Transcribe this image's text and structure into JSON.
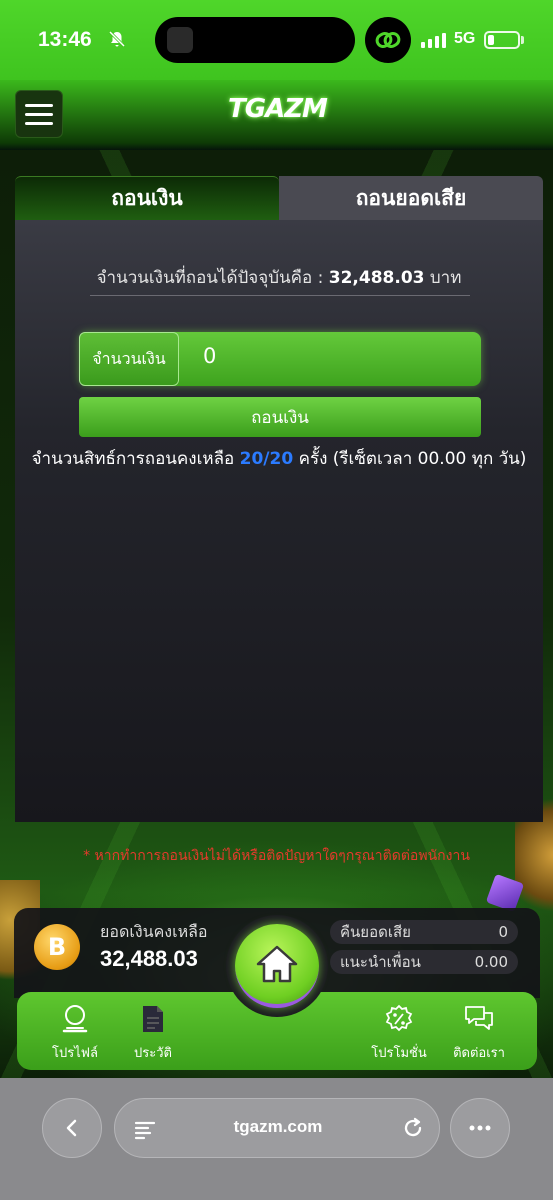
{
  "status_bar": {
    "time": "13:46",
    "network": "5G"
  },
  "header": {
    "logo_text": "TGAZM"
  },
  "tabs": [
    {
      "label": "ถอนเงิน",
      "active": true
    },
    {
      "label": "ถอนยอดเสีย",
      "active": false
    }
  ],
  "withdraw": {
    "available_prefix": "จำนวนเงินที่ถอนได้ปัจจุบันคือ :",
    "available_amount": "32,488.03",
    "available_unit": "บาท",
    "amount_label": "จำนวนเงิน",
    "amount_value": "0",
    "withdraw_button": "ถอนเงิน",
    "rights_prefix": "จำนวนสิทธ์การถอนคงเหลือ",
    "rights_count": "20/20",
    "rights_suffix": "ครั้ง (รีเซ็ตเวลา 00.00 ทุก วัน)"
  },
  "notice": "* หากทำการถอนเงินไม่ได้หรือติดปัญหาใดๆกรุณาติดต่อพนักงาน",
  "balance": {
    "label": "ยอดเงินคงเหลือ",
    "value": "32,488.03",
    "coin_symbol": "B",
    "cashback_label": "คืนยอดเสีย",
    "cashback_value": "0",
    "referral_label": "แนะนำเพื่อน",
    "referral_value": "0.00"
  },
  "bottom_nav": [
    {
      "label": "โปรไฟล์",
      "icon": "profile-icon"
    },
    {
      "label": "ประวัติ",
      "icon": "history-icon"
    },
    {
      "label": "โปรโมชั่น",
      "icon": "promotion-icon"
    },
    {
      "label": "ติดต่อเรา",
      "icon": "chat-icon"
    }
  ],
  "browser": {
    "url": "tgazm.com"
  },
  "colors": {
    "brand_green": "#4fd62a",
    "rights_blue": "#2b7bff",
    "notice_red": "#e53a2c"
  }
}
